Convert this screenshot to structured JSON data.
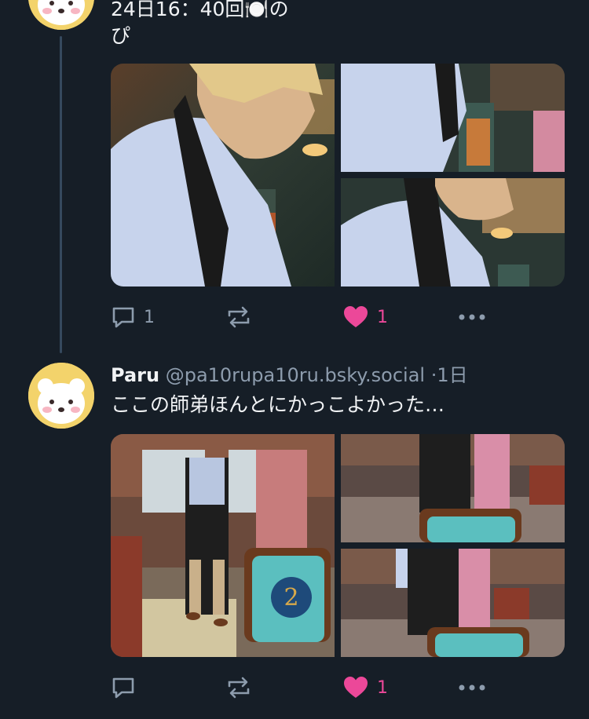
{
  "post1": {
    "text_line1": "24日16：40回🍽️の",
    "text_line2": "ぴ",
    "reply_count": "1",
    "like_count": "1"
  },
  "post2": {
    "author_name": "Paru",
    "author_handle": "@pa10rupa10ru.bsky.social",
    "separator": "·",
    "time": "1日",
    "text": "ここの師弟ほんとにかっこよかった…",
    "reply_count": "",
    "like_count": "1"
  },
  "colors": {
    "background": "#161e27",
    "thread_line": "#35495e",
    "muted": "#8d9cad",
    "like": "#ec4899",
    "avatar_bg": "#f3d36b"
  },
  "icons": [
    "reply-icon",
    "repost-icon",
    "heart-filled-icon",
    "more-icon",
    "bear-avatar-icon"
  ]
}
